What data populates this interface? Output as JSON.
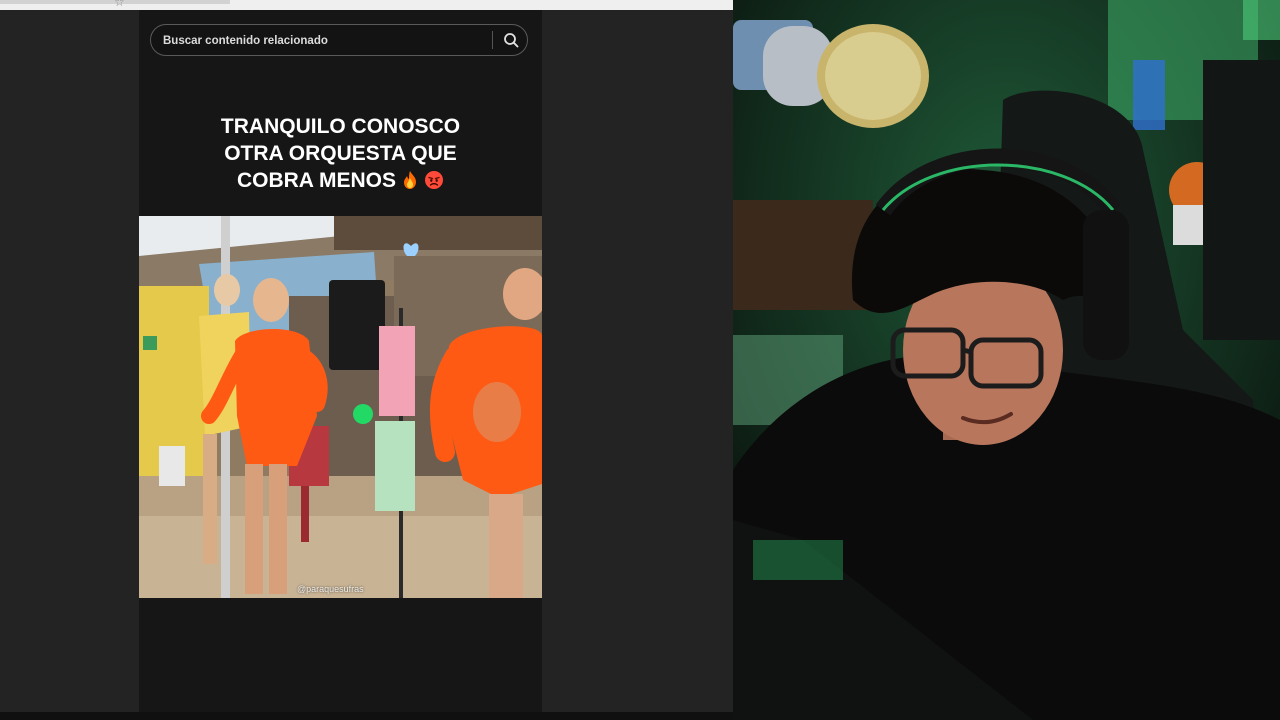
{
  "search": {
    "placeholder": "Buscar contenido relacionado"
  },
  "post": {
    "caption_lines": [
      "TRANQUILO CONOSCO",
      "OTRA ORQUESTA QUE",
      "COBRA MENOS"
    ],
    "caption_emojis": [
      "fire-emoji",
      "angry-face-emoji"
    ],
    "watermark": "@paraquesufras"
  },
  "colors": {
    "page_bg": "#232323",
    "feed_bg": "#161616",
    "costume_orange": "#ff5a14",
    "screen_green": "#1fe06a"
  },
  "icons": {
    "search": "magnifier-icon",
    "bookmark": "star-icon"
  }
}
